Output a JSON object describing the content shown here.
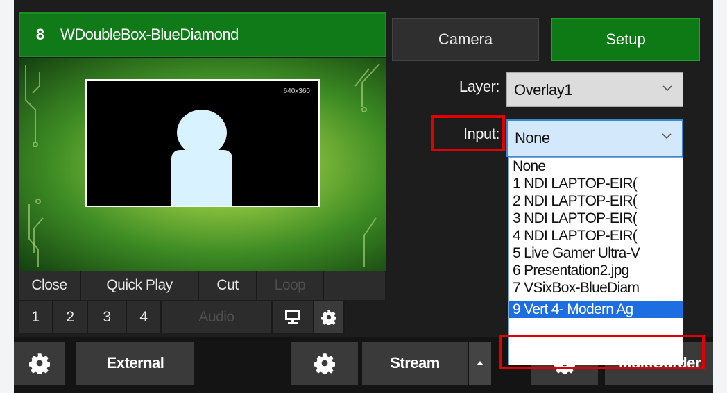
{
  "preview": {
    "number": "8",
    "title": "WDoubleBox-BlueDiamond",
    "resolution": "640x360"
  },
  "controls_row1": [
    "Close",
    "Quick Play",
    "Cut",
    "Loop"
  ],
  "controls_row2": [
    "1",
    "2",
    "3",
    "4",
    "Audio"
  ],
  "bottom_bar": {
    "external_label": "External",
    "stream_label": "Stream",
    "multicorder_label": "MultiCorder"
  },
  "tabs": {
    "camera_label": "Camera",
    "setup_label": "Setup"
  },
  "layer": {
    "label": "Layer:",
    "value": "Overlay1"
  },
  "input": {
    "label": "Input:",
    "value": "None",
    "options": [
      "None",
      "1 NDI LAPTOP-EIR(",
      "2 NDI LAPTOP-EIR(",
      "3 NDI LAPTOP-EIR(",
      "4 NDI LAPTOP-EIR(",
      "5 Live Gamer Ultra-V",
      "6 Presentation2.jpg",
      "7 VSixBox-BlueDiam",
      "9 Vert 4- Modern Ag"
    ],
    "selected_index": 8
  },
  "colors": {
    "accent_green": "#0d7a15",
    "highlight_red": "#e00000",
    "selection_blue": "#1d6ee0"
  }
}
